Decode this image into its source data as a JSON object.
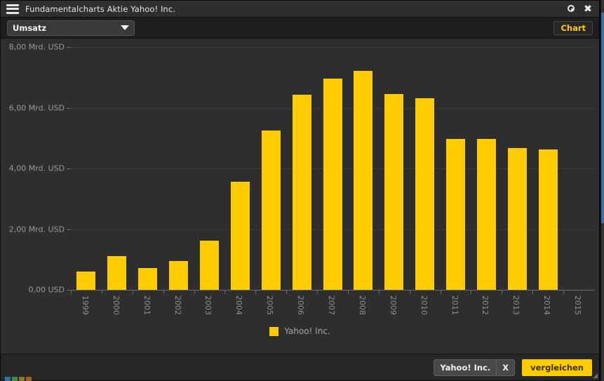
{
  "window": {
    "title": "Fundamentalcharts Aktie Yahoo! Inc.",
    "menu_icon": "hamburger-icon",
    "settings_icon": "gear-icon",
    "close_icon": "close-icon"
  },
  "toolbar": {
    "metric_selected": "Umsatz",
    "metric_options": [
      "Umsatz"
    ],
    "caret_icon": "chevron-down-icon",
    "chart_button": "Chart"
  },
  "footer": {
    "chip_label": "Yahoo! Inc.",
    "chip_remove_label": "X",
    "compare_button": "vergleichen",
    "resize_grip": "◢"
  },
  "colors": {
    "bar": "#ffcc00",
    "accent": "#ffcc00",
    "panel": "#2e2e2e",
    "titlebar": "#2e2e2e",
    "toolbar": "#1e1e1e",
    "grid": "#3d3d3d",
    "axis_text": "#8f8f8f"
  },
  "taskbar_peek": [
    "#2f6fb5",
    "#3f9142",
    "#8a7b2a",
    "#a85b22"
  ],
  "chart_data": {
    "type": "bar",
    "title": "",
    "xlabel": "",
    "ylabel": "",
    "unit": "Mrd. USD",
    "grid": true,
    "legend_position": "bottom",
    "ylim": [
      0,
      8
    ],
    "ytick_labels": [
      "8,00 Mrd. USD",
      "6,00 Mrd. USD",
      "4,00 Mrd. USD",
      "2,00 Mrd. USD",
      "0,00 USD"
    ],
    "yticks": [
      8,
      6,
      4,
      2,
      0
    ],
    "categories": [
      "1999",
      "2000",
      "2001",
      "2002",
      "2003",
      "2004",
      "2005",
      "2006",
      "2007",
      "2008",
      "2009",
      "2010",
      "2011",
      "2012",
      "2013",
      "2014",
      "2015"
    ],
    "series": [
      {
        "name": "Yahoo! Inc.",
        "color": "#ffcc00",
        "values": [
          0.59,
          1.11,
          0.72,
          0.95,
          1.63,
          3.57,
          5.26,
          6.43,
          6.97,
          7.21,
          6.46,
          6.32,
          4.98,
          4.98,
          4.68,
          4.62,
          null
        ]
      }
    ],
    "legend": [
      "Yahoo! Inc."
    ]
  }
}
